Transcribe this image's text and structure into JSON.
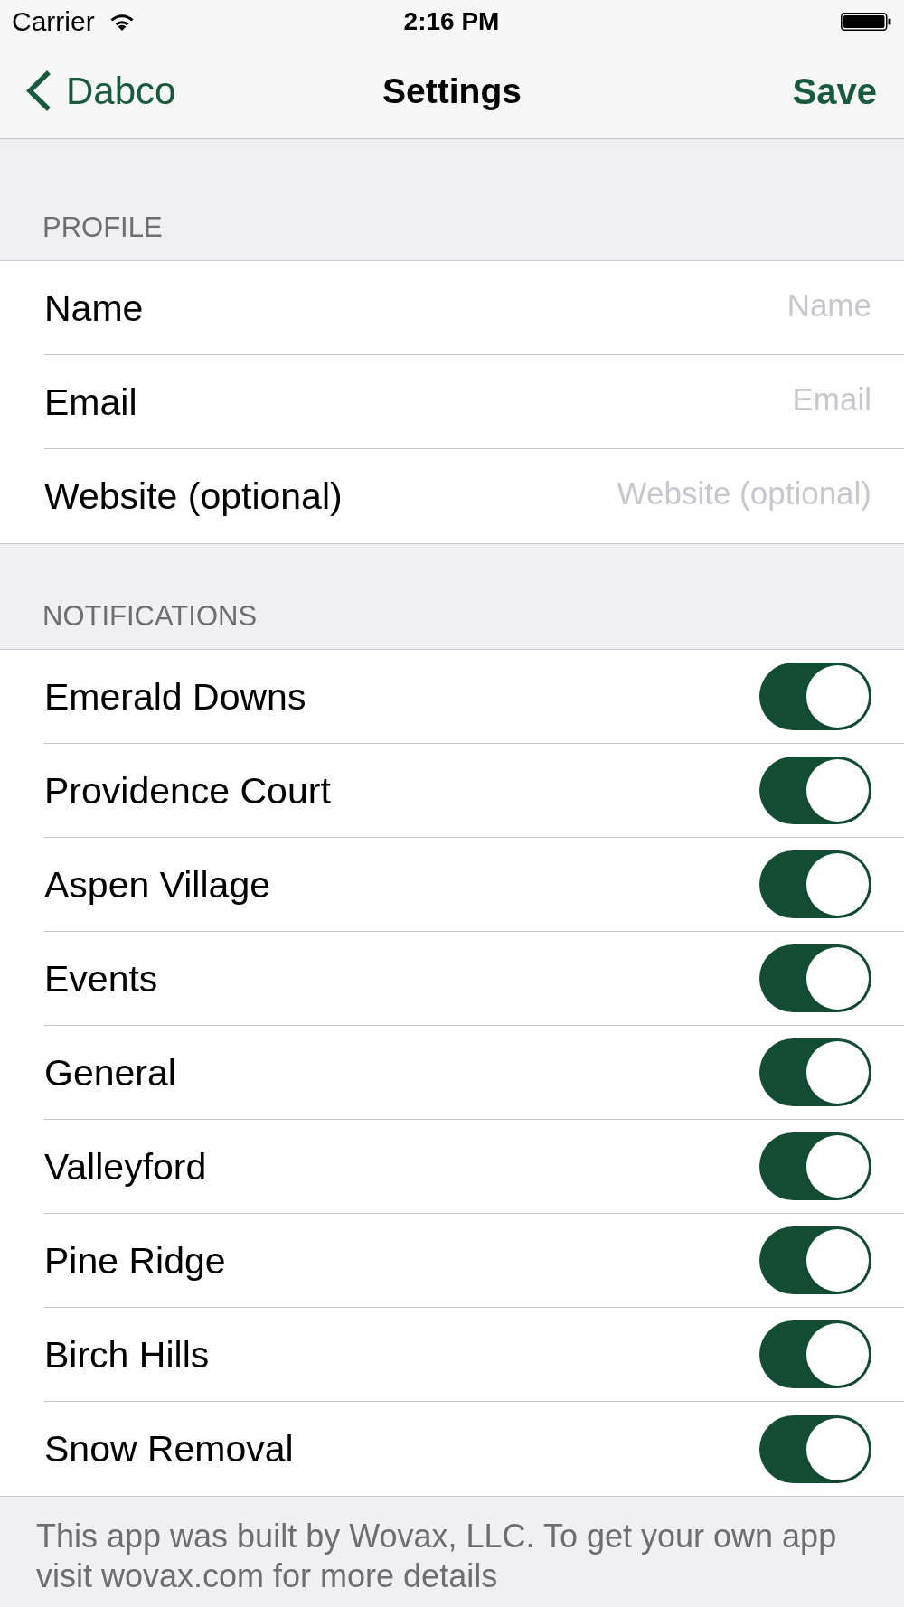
{
  "status_bar": {
    "carrier": "Carrier",
    "time": "2:16 PM"
  },
  "nav_bar": {
    "back": "Dabco",
    "title": "Settings",
    "action": "Save"
  },
  "profile": {
    "header": "PROFILE",
    "fields": [
      {
        "label": "Name",
        "placeholder": "Name"
      },
      {
        "label": "Email",
        "placeholder": "Email"
      },
      {
        "label": "Website (optional)",
        "placeholder": "Website (optional)"
      }
    ]
  },
  "notifications": {
    "header": "NOTIFICATIONS",
    "items": [
      {
        "label": "Emerald Downs",
        "on": true
      },
      {
        "label": "Providence Court",
        "on": true
      },
      {
        "label": "Aspen Village",
        "on": true
      },
      {
        "label": "Events",
        "on": true
      },
      {
        "label": "General",
        "on": true
      },
      {
        "label": "Valleyford",
        "on": true
      },
      {
        "label": "Pine Ridge",
        "on": true
      },
      {
        "label": "Birch Hills",
        "on": true
      },
      {
        "label": "Snow Removal",
        "on": true
      }
    ]
  },
  "footer": "This app was built by Wovax, LLC. To get your own app visit wovax.com for more details"
}
